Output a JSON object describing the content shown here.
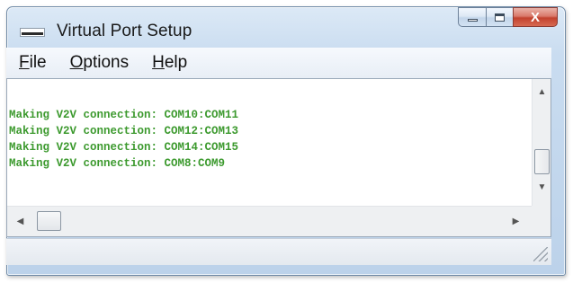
{
  "window": {
    "title": "Virtual Port Setup",
    "icon": "serial-port-app-icon",
    "caption_buttons": {
      "minimize_icon": "minimize-icon",
      "maximize_icon": "maximize-icon",
      "close_icon": "close-icon",
      "close_glyph": "X"
    }
  },
  "menu": {
    "items": [
      {
        "accel": "F",
        "rest": "ile"
      },
      {
        "accel": "O",
        "rest": "ptions"
      },
      {
        "accel": "H",
        "rest": "elp"
      }
    ]
  },
  "log": {
    "text_color": "#3d9a2f",
    "lines": [
      "Making V2V connection: COM10:COM11",
      "Making V2V connection: COM12:COM13",
      "Making V2V connection: COM14:COM15",
      "Making V2V connection: COM8:COM9"
    ]
  },
  "scrollbars": {
    "vertical": {
      "up_icon": "scroll-up-arrow-icon",
      "down_icon": "scroll-down-arrow-icon",
      "up_glyph": "▲",
      "down_glyph": "▼"
    },
    "horizontal": {
      "left_icon": "scroll-left-arrow-icon",
      "right_icon": "scroll-right-arrow-icon",
      "left_glyph": "◀",
      "right_glyph": "▶"
    }
  },
  "statusbar": {
    "text": ""
  }
}
